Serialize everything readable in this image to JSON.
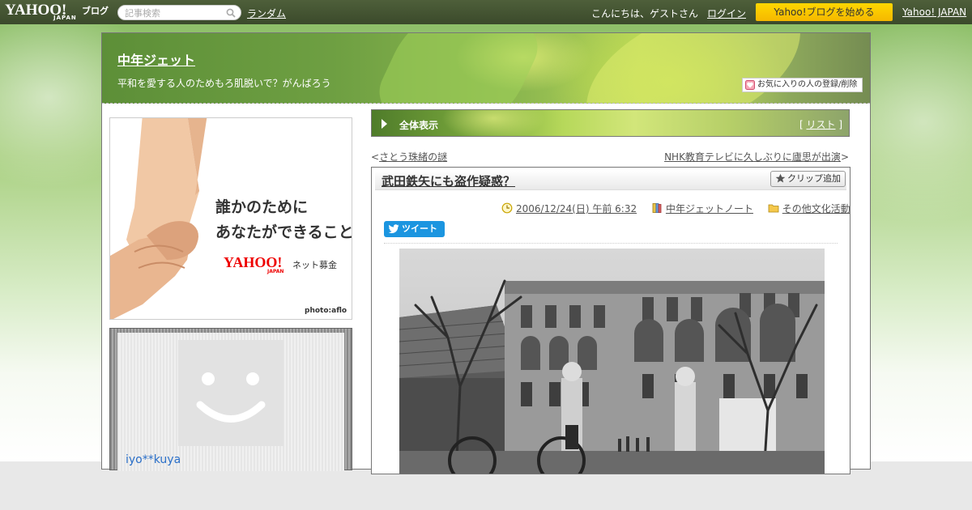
{
  "topbar": {
    "logo": "YAHOO!",
    "logo_sub": "JAPAN",
    "logo_blog": "ブログ",
    "search_placeholder": "記事検索",
    "random_link": "ランダム",
    "greeting": "こんにちは、ゲストさん",
    "login_link": "ログイン",
    "start_button": "Yahoo!ブログを始める",
    "yahoo_japan_link": "Yahoo! JAPAN"
  },
  "blog": {
    "title": "中年ジェット",
    "description": "平和を愛する人のためもろ肌脱いで？がんばろう",
    "favorite_button": "お気に入りの人の登録/削除"
  },
  "ad": {
    "line1": "誰かのために",
    "line2": "あなたができること",
    "logo": "YAHOO!",
    "logo_sub": "JAPAN",
    "fund": "ネット募金",
    "credit": "photo:aflo"
  },
  "profile": {
    "name": "iyo**kuya"
  },
  "view_bar": {
    "label": "全体表示",
    "list_prefix": "[ ",
    "list_link": "リスト",
    "list_suffix": " ]"
  },
  "nav": {
    "prev_mark": "<",
    "prev": "さとう珠緒の謎",
    "next": "NHK教育テレビに久しぶりに廬思が出演",
    "next_mark": ">"
  },
  "article": {
    "title": "武田鉄矢にも盗作疑惑？",
    "clip_button": "クリップ追加",
    "date": "2006/12/24(日) 午前 6:32",
    "category": "中年ジェットノート",
    "folder": "その他文化活動",
    "tweet_button": "ツイート"
  },
  "colors": {
    "topbar": "#3f4e2e",
    "accent_yellow": "#f8c300",
    "link_blue": "#2a6fc8",
    "tweet_blue": "#1b95e0"
  }
}
